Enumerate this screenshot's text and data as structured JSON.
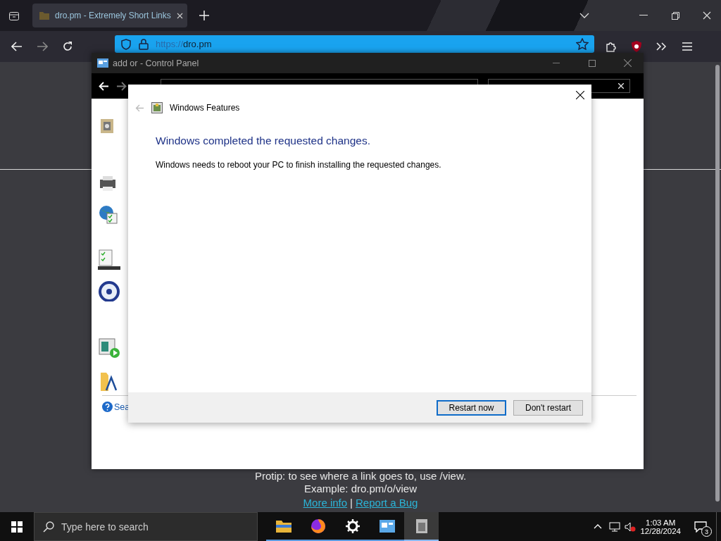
{
  "browser": {
    "tab": {
      "title": "dro.pm - Extremely Short Links",
      "selected": true
    },
    "url": {
      "scheme": "https://",
      "host": "dro.pm"
    },
    "page": {
      "protip": "Protip: to see where a link goes to, use /view.",
      "example": "Example: dro.pm/o/view",
      "links": [
        "More info",
        "Report a Bug"
      ],
      "separator": "|"
    }
  },
  "control_panel": {
    "title": "add or - Control Panel",
    "help_link": "Sea"
  },
  "dialog": {
    "title": "Windows Features",
    "heading": "Windows completed the requested changes.",
    "message": "Windows needs to reboot your PC to finish installing the requested changes.",
    "buttons": [
      {
        "label": "Restart now",
        "default": true
      },
      {
        "label": "Don't restart",
        "default": false
      }
    ]
  },
  "taskbar": {
    "search_placeholder": "Type here to search",
    "time": "1:03 AM",
    "date": "12/28/2024",
    "notification_count": "3"
  }
}
